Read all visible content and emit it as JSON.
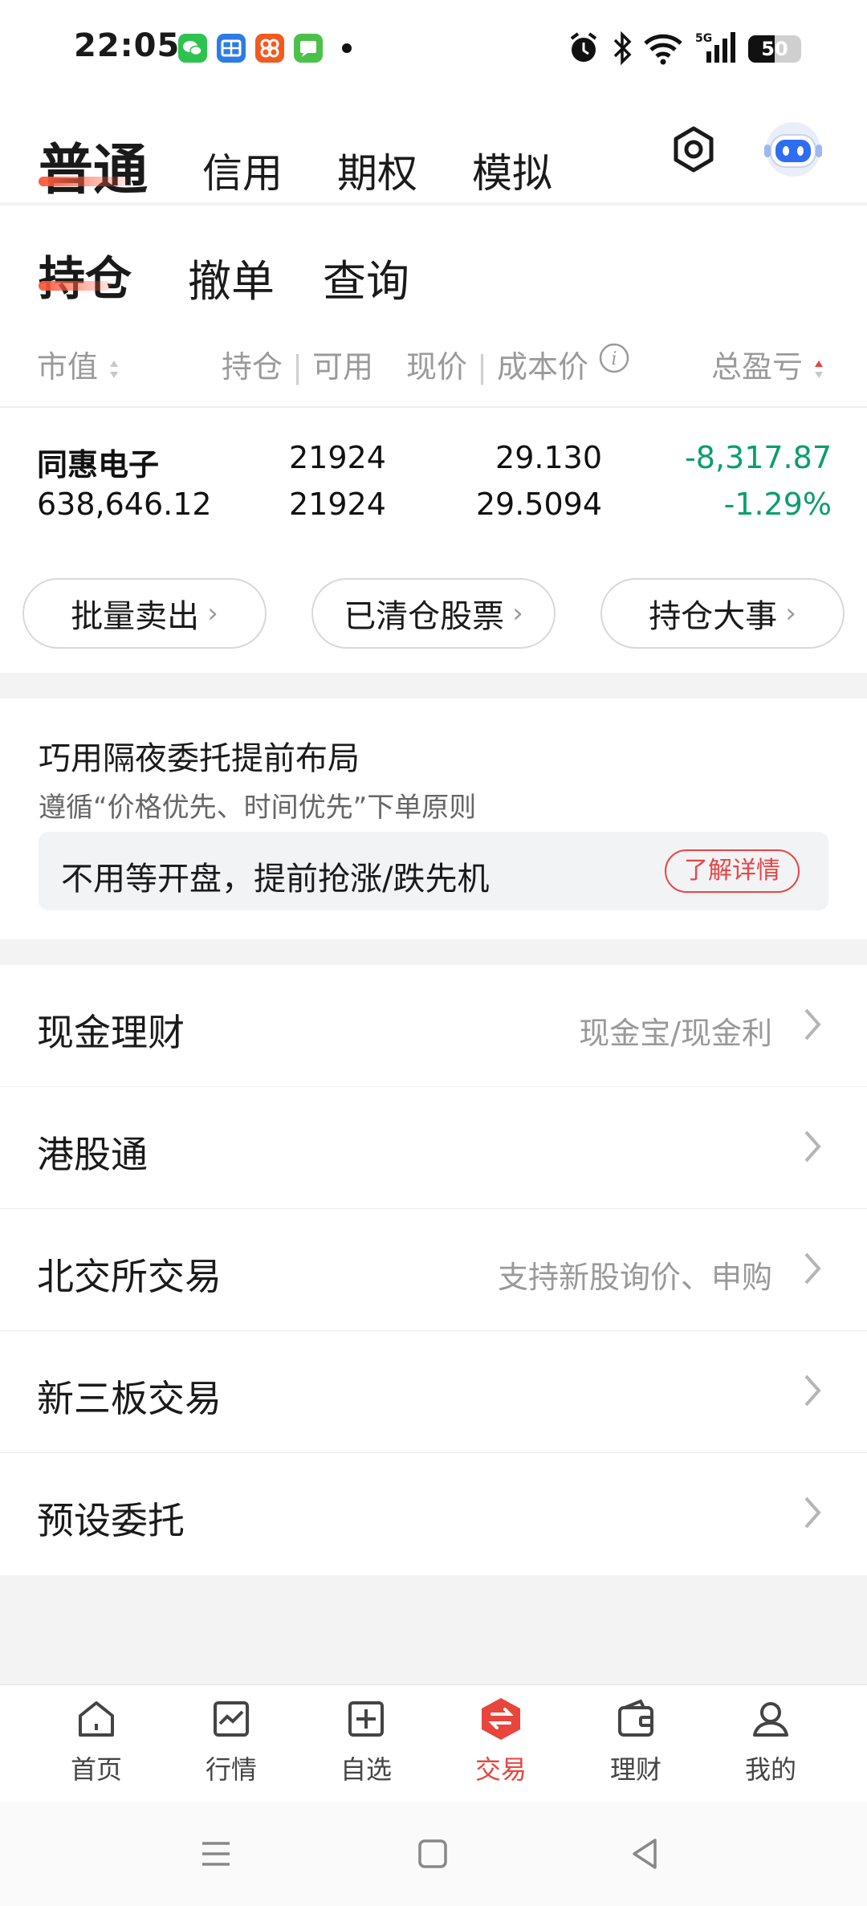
{
  "status_bar": {
    "time": "22:05",
    "battery": "50",
    "battery_level": 0.5,
    "icons": [
      "wechat-icon",
      "app-yan-icon",
      "app-orange-icon",
      "message-icon",
      "alarm-icon",
      "bluetooth-icon",
      "wifi-icon",
      "5g-signal-icon",
      "battery-icon"
    ]
  },
  "account_tabs": [
    "普通",
    "信用",
    "期权",
    "模拟"
  ],
  "account_active": 0,
  "sub_tabs": [
    "持仓",
    "撤单",
    "查询"
  ],
  "sub_active": 0,
  "columns": {
    "market_value": "市值",
    "position": "持仓",
    "available": "可用",
    "price": "现价",
    "cost": "成本价",
    "pnl": "总盈亏"
  },
  "holding": {
    "name": "同惠电子",
    "market_value": "638,646.12",
    "position": "21924",
    "available": "21924",
    "price": "29.130",
    "cost": "29.5094",
    "pnl": "-8,317.87",
    "pnl_pct": "-1.29%"
  },
  "action_pills": [
    "批量卖出",
    "已清仓股票",
    "持仓大事"
  ],
  "promo": {
    "title": "巧用隔夜委托提前布局",
    "subtitle": "遵循“价格优先、时间优先”下单原则",
    "box_text": "不用等开盘，提前抢涨/跌先机",
    "button": "了解详情"
  },
  "menu": [
    {
      "label": "现金理财",
      "hint": "现金宝/现金利"
    },
    {
      "label": "港股通",
      "hint": ""
    },
    {
      "label": "北交所交易",
      "hint": "支持新股询价、申购"
    },
    {
      "label": "新三板交易",
      "hint": ""
    },
    {
      "label": "预设委托",
      "hint": ""
    }
  ],
  "bottom_nav": [
    {
      "label": "首页",
      "icon": "home-icon"
    },
    {
      "label": "行情",
      "icon": "chart-icon"
    },
    {
      "label": "自选",
      "icon": "add-square-icon"
    },
    {
      "label": "交易",
      "icon": "trade-exchange-icon"
    },
    {
      "label": "理财",
      "icon": "wallet-icon"
    },
    {
      "label": "我的",
      "icon": "profile-icon"
    }
  ],
  "bottom_nav_active": 3,
  "colors": {
    "accent_red": "#e8453c",
    "loss_green": "#0a9e6b"
  }
}
